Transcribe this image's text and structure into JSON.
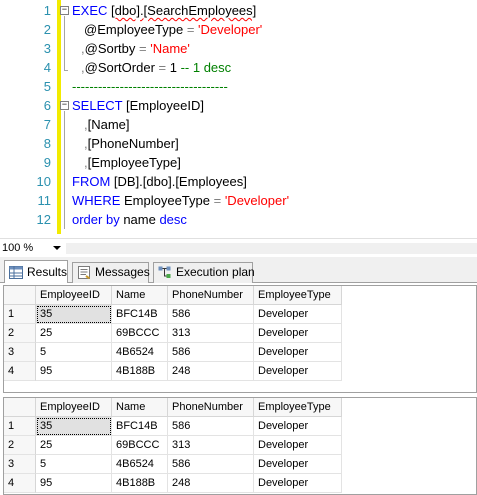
{
  "editor": {
    "line_numbers": [
      "1",
      "2",
      "3",
      "4",
      "5",
      "6",
      "7",
      "8",
      "9",
      "10",
      "11",
      "12"
    ],
    "line1": {
      "exec": "EXEC",
      "proc": "[dbo].[SearchEmployees]"
    },
    "line2": {
      "param": "@EmployeeType",
      "eq": " = ",
      "value": "'Developer'"
    },
    "line3": {
      "comma": ",",
      "param": "@Sortby",
      "eq": " = ",
      "value": "'Name'"
    },
    "line4": {
      "comma": ",",
      "param": "@SortOrder",
      "eq": " = ",
      "value": "1",
      "comment": " -- 1 desc"
    },
    "line5": {
      "dashes": "------------------------------------"
    },
    "line6": {
      "select": "SELECT",
      "col": " [EmployeeID]"
    },
    "line7": {
      "comma": ",",
      "col": "[Name]"
    },
    "line8": {
      "comma": ",",
      "col": "[PhoneNumber]"
    },
    "line9": {
      "comma": ",",
      "col": "[EmployeeType]"
    },
    "line10": {
      "from": "FROM",
      "table": " [DB].[dbo].[Employees]"
    },
    "line11": {
      "where": "WHERE",
      "col": " EmployeeType ",
      "eq": "= ",
      "value": "'Developer'"
    },
    "line12": {
      "order": "order by",
      "col": " name ",
      "desc": "desc"
    }
  },
  "zoom": {
    "value": "100 %"
  },
  "tabs": [
    {
      "label": "Results",
      "icon": "results-grid-icon"
    },
    {
      "label": "Messages",
      "icon": "messages-icon"
    },
    {
      "label": "Execution plan",
      "icon": "execution-plan-icon"
    }
  ],
  "grid1": {
    "columns": [
      "EmployeeID",
      "Name",
      "PhoneNumber",
      "EmployeeType"
    ],
    "rows": [
      {
        "num": "1",
        "cells": [
          "35",
          "BFC14B",
          "586",
          "Developer"
        ]
      },
      {
        "num": "2",
        "cells": [
          "25",
          "69BCCC",
          "313",
          "Developer"
        ]
      },
      {
        "num": "3",
        "cells": [
          "5",
          "4B6524",
          "586",
          "Developer"
        ]
      },
      {
        "num": "4",
        "cells": [
          "95",
          "4B188B",
          "248",
          "Developer"
        ]
      }
    ]
  },
  "grid2": {
    "columns": [
      "EmployeeID",
      "Name",
      "PhoneNumber",
      "EmployeeType"
    ],
    "rows": [
      {
        "num": "1",
        "cells": [
          "35",
          "BFC14B",
          "586",
          "Developer"
        ]
      },
      {
        "num": "2",
        "cells": [
          "25",
          "69BCCC",
          "313",
          "Developer"
        ]
      },
      {
        "num": "3",
        "cells": [
          "5",
          "4B6524",
          "586",
          "Developer"
        ]
      },
      {
        "num": "4",
        "cells": [
          "95",
          "4B188B",
          "248",
          "Developer"
        ]
      }
    ]
  },
  "colors": {
    "keyword": "#0000ff",
    "string": "#ff0000",
    "comment": "#008000",
    "line_number": "#2b91af",
    "change_bar": "#f2eb00"
  }
}
